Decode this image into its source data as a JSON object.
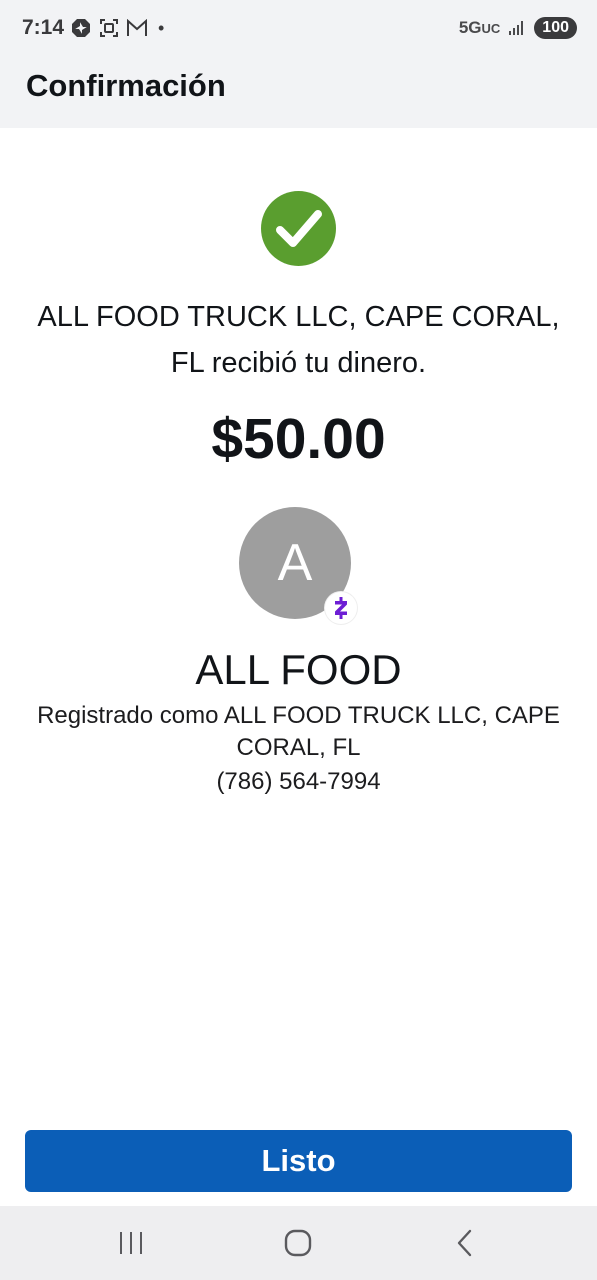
{
  "status_bar": {
    "time": "7:14",
    "network": "5G",
    "network_suffix": "UC",
    "battery": "100",
    "icons": [
      "chase-icon",
      "screen-record-icon",
      "gmail-icon",
      "notification-dot-icon",
      "signal-icon"
    ]
  },
  "header": {
    "title": "Confirmación"
  },
  "confirmation": {
    "message": "ALL FOOD TRUCK LLC, CAPE CORAL, FL recibió tu dinero.",
    "amount": "$50.00",
    "success_color": "#5a9e2f"
  },
  "recipient": {
    "avatar_initial": "A",
    "avatar_color": "#9e9e9e",
    "badge_icon": "zelle-icon",
    "badge_color": "#6d1ed4",
    "name": "ALL FOOD",
    "registered_as": "Registrado como ALL FOOD TRUCK LLC, CAPE CORAL, FL",
    "phone": "(786) 564-7994"
  },
  "actions": {
    "done_label": "Listo",
    "button_color": "#0b5eb7"
  },
  "nav_bar": {
    "items": [
      "recent-apps-icon",
      "home-icon",
      "back-icon"
    ]
  }
}
